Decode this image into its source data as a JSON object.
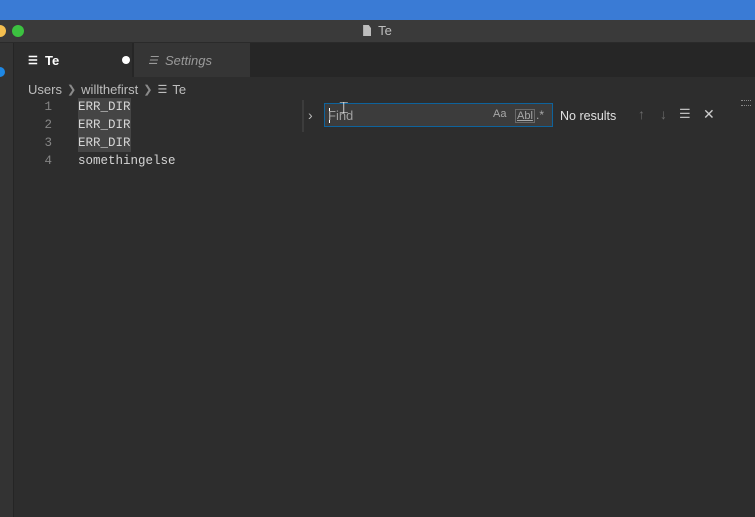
{
  "window": {
    "title": "Te"
  },
  "tabs": [
    {
      "label": "Te",
      "active": true,
      "dirty": true
    },
    {
      "label": "Settings",
      "active": false,
      "preview": true
    }
  ],
  "breadcrumb": {
    "parts": [
      "Users",
      "willthefirst",
      "Te"
    ]
  },
  "editor": {
    "lines": [
      {
        "number": "1",
        "text": "ERR_DIR"
      },
      {
        "number": "2",
        "text": "ERR_DIR"
      },
      {
        "number": "3",
        "text": "ERR_DIR"
      },
      {
        "number": "4",
        "text": "somethingelse"
      }
    ]
  },
  "find": {
    "placeholder": "Find",
    "value": "",
    "match_case_label": "Aa",
    "whole_word_label": "Abl",
    "regex_label": ".*",
    "result_text": "No results"
  },
  "colors": {
    "accent": "#0e639c",
    "editor_bg": "#2d2d2d",
    "desktop_blue": "#3a7bd5",
    "dirty_dot": "#ffffff"
  }
}
